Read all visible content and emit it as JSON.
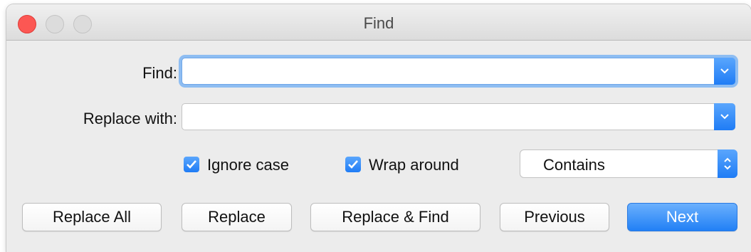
{
  "window": {
    "title": "Find"
  },
  "find": {
    "label": "Find:",
    "value": ""
  },
  "replace": {
    "label": "Replace with:",
    "value": ""
  },
  "options": {
    "ignore_case": {
      "label": "Ignore case",
      "checked": true
    },
    "wrap_around": {
      "label": "Wrap around",
      "checked": true
    },
    "match_mode": {
      "selected": "Contains"
    }
  },
  "buttons": {
    "replace_all": "Replace All",
    "replace": "Replace",
    "replace_and_find": "Replace & Find",
    "previous": "Previous",
    "next": "Next"
  },
  "colors": {
    "accent": "#1f7cf5",
    "close": "#fc5753",
    "focus_ring": "#8ebdf2"
  }
}
